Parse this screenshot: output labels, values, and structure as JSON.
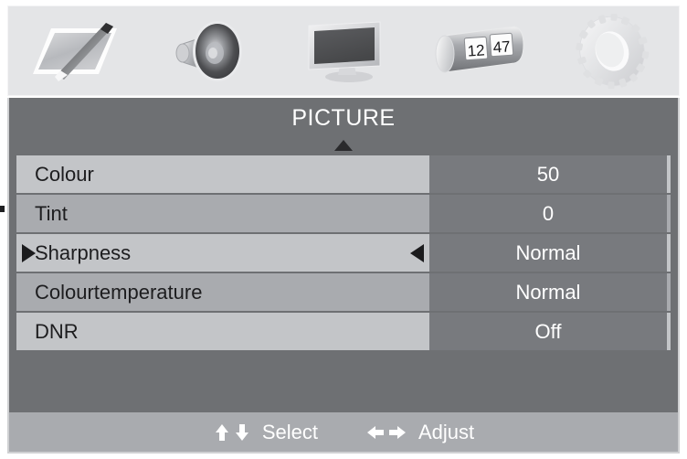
{
  "menu": {
    "title": "PICTURE",
    "category_icons": [
      {
        "name": "picture-canvas-brush-icon",
        "label": "Picture"
      },
      {
        "name": "speaker-sound-icon",
        "label": "Sound"
      },
      {
        "name": "tv-screen-icon",
        "label": "Screen"
      },
      {
        "name": "digital-clock-icon",
        "label": "Time",
        "clock_hours": "12",
        "clock_minutes": "47"
      },
      {
        "name": "gear-setup-icon",
        "label": "Setup"
      }
    ],
    "rows": [
      {
        "label": "Colour",
        "value": "50",
        "selected": false
      },
      {
        "label": "Tint",
        "value": "0",
        "selected": false
      },
      {
        "label": "Sharpness",
        "value": "Normal",
        "selected": true
      },
      {
        "label": "Colourtemperature",
        "value": "Normal",
        "selected": false
      },
      {
        "label": "DNR",
        "value": "Off",
        "selected": false
      }
    ],
    "footer": {
      "select_label": "Select",
      "adjust_label": "Adjust",
      "up_arrow": "↑",
      "down_arrow": "↓",
      "left_arrow": "←",
      "right_arrow": "→"
    },
    "colors": {
      "icon_bar_bg": "#e4e5e7",
      "title_bg": "#6e7073",
      "row_odd_bg": "#c3c5c8",
      "row_even_bg": "#a9abaf",
      "value_bg": "#787a7e",
      "footer_bg": "#a9abaf",
      "text_dark": "#1d1d1f",
      "text_light": "#ffffff"
    }
  }
}
